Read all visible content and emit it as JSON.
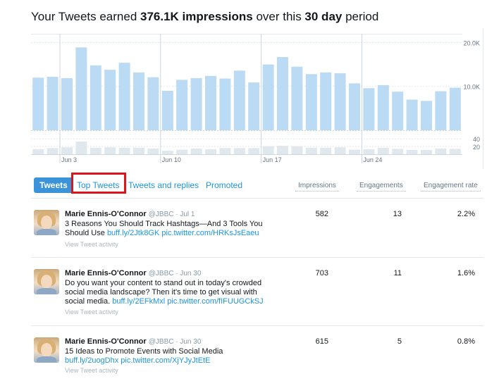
{
  "headline": {
    "prefix": "Your Tweets earned ",
    "impressions": "376.1K impressions",
    "middle": " over this ",
    "period": "30 day",
    "suffix": " period"
  },
  "chart_data": {
    "type": "bar",
    "title": "",
    "xlabel": "",
    "ylabel": "",
    "impressions": {
      "values": [
        12000,
        12200,
        11900,
        18900,
        14800,
        13800,
        15400,
        13200,
        12100,
        9000,
        11500,
        11900,
        12400,
        11800,
        13600,
        10900,
        15000,
        16700,
        14500,
        12800,
        13200,
        13000,
        10700,
        9600,
        10300,
        8800,
        7000,
        6700,
        8900,
        9700
      ],
      "ylim": [
        0,
        22000
      ],
      "y_tick_labels": [
        "20.0K",
        "10.0K"
      ],
      "y_ticks": [
        20000,
        10000
      ]
    },
    "engagements": {
      "values": [
        13,
        16,
        18,
        33,
        17,
        18,
        17,
        17,
        15,
        9,
        12,
        15,
        13,
        16,
        16,
        16,
        21,
        22,
        21,
        17,
        17,
        18,
        12,
        13,
        17,
        14,
        11,
        11,
        15,
        14
      ],
      "ylim": [
        0,
        42
      ],
      "y_tick_labels": [
        "40",
        "20"
      ],
      "y_ticks": [
        40,
        20
      ]
    },
    "x_tick_labels": [
      {
        "index": 2,
        "label": "Jun 3"
      },
      {
        "index": 9,
        "label": "Jun 10"
      },
      {
        "index": 16,
        "label": "Jun 17"
      },
      {
        "index": 23,
        "label": "Jun 24"
      }
    ],
    "grid": true,
    "colors": {
      "impressions": "#bbdaf3",
      "engagements": "#e1e8ed"
    }
  },
  "tabs": [
    {
      "label": "Tweets",
      "active": true
    },
    {
      "label": "Top Tweets",
      "active": false
    },
    {
      "label": "Tweets and replies",
      "active": false
    },
    {
      "label": "Promoted",
      "active": false
    }
  ],
  "columns": {
    "impressions": "Impressions",
    "engagements": "Engagements",
    "engagement_rate": "Engagement rate"
  },
  "tweets": [
    {
      "name": "Marie Ennis-O'Connor",
      "handle": "@JBBC · Jul 1",
      "text": "3 Reasons You Should Track Hashtags—And 3 Tools You Should Use",
      "links": "buff.ly/2Jtk8GK pic.twitter.com/HRKsJsEaeu",
      "activity": "View Tweet activity",
      "impressions": "582",
      "engagements": "13",
      "rate": "2.2%"
    },
    {
      "name": "Marie Ennis-O'Connor",
      "handle": "@JBBC · Jun 30",
      "text": "Do you want your content to stand out in today's crowded social media landscape? Then it's time to get visual with social media.",
      "links": "buff.ly/2EFkMxl pic.twitter.com/fIFUUGCkSJ",
      "activity": "View Tweet activity",
      "impressions": "703",
      "engagements": "11",
      "rate": "1.6%"
    },
    {
      "name": "Marie Ennis-O'Connor",
      "handle": "@JBBC · Jun 30",
      "text": "15 Ideas to Promote Events with Social Media",
      "links": "buff.ly/2uogDhx pic.twitter.com/XjYJyJtEtE",
      "activity": "View Tweet activity",
      "impressions": "615",
      "engagements": "5",
      "rate": "0.8%"
    }
  ],
  "colors": {
    "accent": "#1b95e0",
    "active_tab": "#3b94d9",
    "highlight": "#e0151b"
  }
}
